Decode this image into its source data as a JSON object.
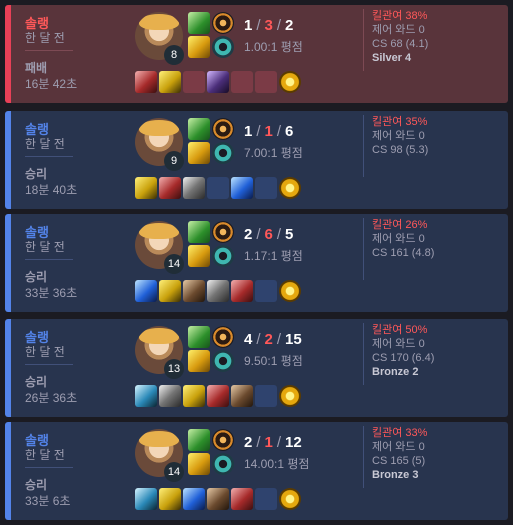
{
  "matches": [
    {
      "outcome": "loss",
      "mode": "솔랭",
      "when": "한 달 전",
      "result": "패배",
      "duration": "16분 42초",
      "level": "8",
      "kills": "1",
      "deaths": "3",
      "assists": "2",
      "ratio": "1.00:1 평점",
      "kp": "킬관여 38%",
      "wards": "제어 와드 0",
      "cs": "CS 68 (4.1)",
      "tier": "Silver 4",
      "items": [
        "i-red",
        "i-gold",
        "empty",
        "i-purple",
        "empty",
        "empty",
        "i-ward"
      ]
    },
    {
      "outcome": "win",
      "mode": "솔랭",
      "when": "한 달 전",
      "result": "승리",
      "duration": "18분 40초",
      "level": "9",
      "kills": "1",
      "deaths": "1",
      "assists": "6",
      "ratio": "7.00:1 평점",
      "kp": "킬관여 35%",
      "wards": "제어 와드 0",
      "cs": "CS 98 (5.3)",
      "tier": "",
      "items": [
        "i-gold",
        "i-red",
        "i-sword",
        "empty",
        "i-blue",
        "empty",
        "i-ward"
      ]
    },
    {
      "outcome": "win",
      "mode": "솔랭",
      "when": "한 달 전",
      "result": "승리",
      "duration": "33분 36초",
      "level": "14",
      "kills": "2",
      "deaths": "6",
      "assists": "5",
      "ratio": "1.17:1 평점",
      "kp": "킬관여 26%",
      "wards": "제어 와드 0",
      "cs": "CS 161 (4.8)",
      "tier": "",
      "items": [
        "i-blue",
        "i-gold",
        "i-brown",
        "i-sword",
        "i-red",
        "empty",
        "i-ward"
      ]
    },
    {
      "outcome": "win",
      "mode": "솔랭",
      "when": "한 달 전",
      "result": "승리",
      "duration": "26분 36초",
      "level": "13",
      "kills": "4",
      "deaths": "2",
      "assists": "15",
      "ratio": "9.50:1 평점",
      "kp": "킬관여 50%",
      "wards": "제어 와드 0",
      "cs": "CS 170 (6.4)",
      "tier": "Bronze 2",
      "items": [
        "i-cyan",
        "i-sword",
        "i-gold",
        "i-red",
        "i-brown",
        "empty",
        "i-ward"
      ]
    },
    {
      "outcome": "win",
      "mode": "솔랭",
      "when": "한 달 전",
      "result": "승리",
      "duration": "33분 6초",
      "level": "14",
      "kills": "2",
      "deaths": "1",
      "assists": "12",
      "ratio": "14.00:1 평점",
      "kp": "킬관여 33%",
      "wards": "제어 와드 0",
      "cs": "CS 165 (5)",
      "tier": "Bronze 3",
      "items": [
        "i-cyan",
        "i-gold",
        "i-blue",
        "i-brown",
        "i-red",
        "empty",
        "i-ward"
      ]
    }
  ]
}
